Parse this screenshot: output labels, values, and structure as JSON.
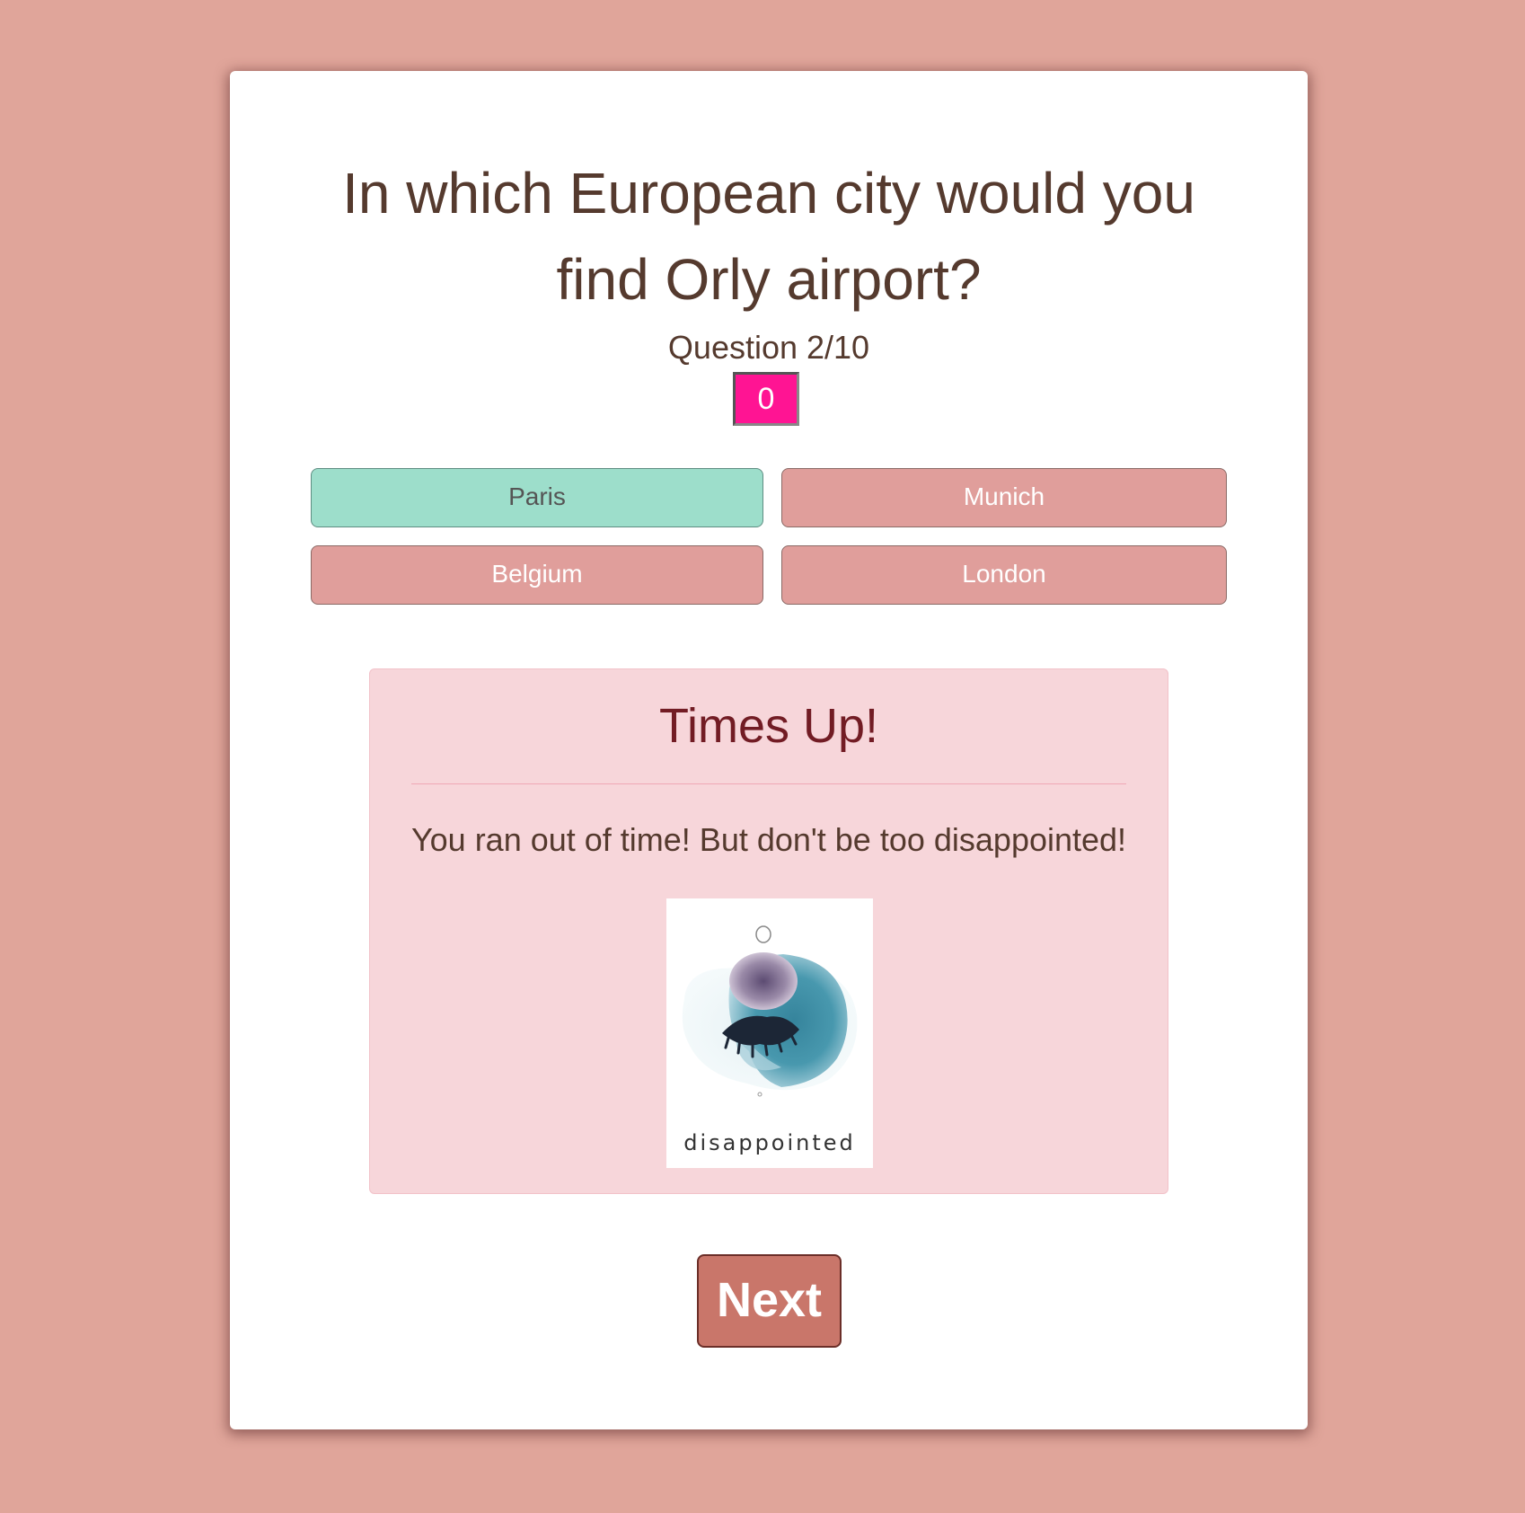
{
  "quiz": {
    "question": "In which European city would you find Orly airport?",
    "counter": "Question 2/10",
    "timer": "0",
    "answers": [
      {
        "label": "Paris",
        "state": "correct"
      },
      {
        "label": "Munich",
        "state": "incorrect"
      },
      {
        "label": "Belgium",
        "state": "incorrect"
      },
      {
        "label": "London",
        "state": "incorrect"
      }
    ],
    "next_label": "Next"
  },
  "result": {
    "title": "Times Up!",
    "message": "You ran out of time! But don't be too disappointed!",
    "image_caption": "disappointed"
  },
  "colors": {
    "page_background": "#e0a59a",
    "timer_background": "#ff1493",
    "correct_answer": "#9ddecb",
    "incorrect_answer": "#e09e9b",
    "alert_background": "#f7d6da",
    "alert_title": "#721c24",
    "next_button": "#c9766a"
  }
}
